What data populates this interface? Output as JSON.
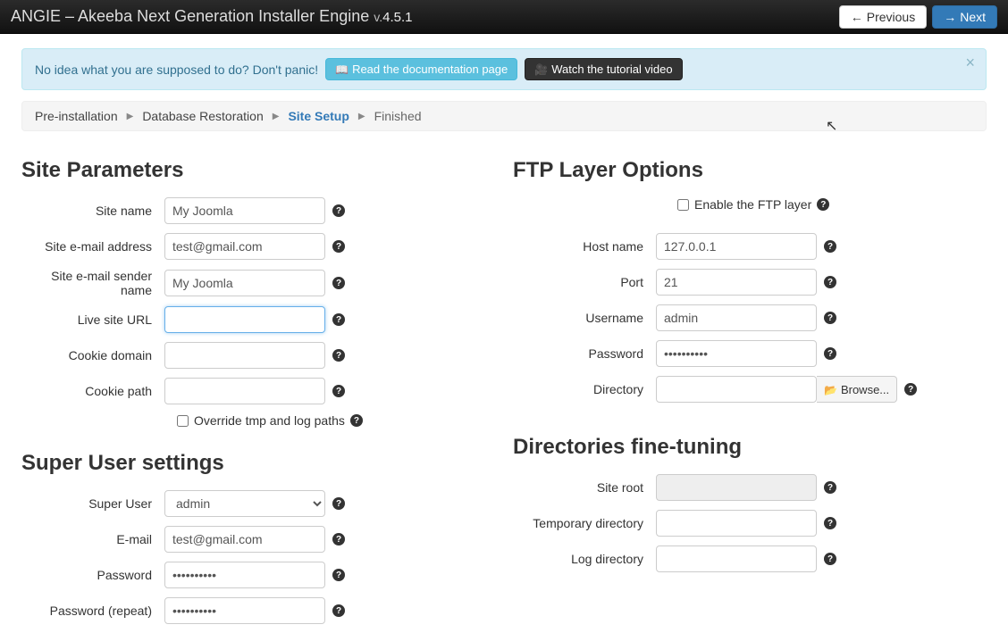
{
  "navbar": {
    "brand": "ANGIE – Akeeba Next Generation Installer Engine",
    "version_label": "v.",
    "version": "4.5.1",
    "prev": "Previous",
    "next": "Next"
  },
  "alert": {
    "text": "No idea what you are supposed to do? Don't panic!",
    "doc_btn": "Read the documentation page",
    "video_btn": "Watch the tutorial video"
  },
  "breadcrumb": {
    "items": [
      "Pre-installation",
      "Database Restoration",
      "Site Setup",
      "Finished"
    ],
    "active_index": 2
  },
  "site_params": {
    "heading": "Site Parameters",
    "labels": {
      "site_name": "Site name",
      "site_email": "Site e-mail address",
      "site_email_sender": "Site e-mail sender name",
      "live_url": "Live site URL",
      "cookie_domain": "Cookie domain",
      "cookie_path": "Cookie path",
      "override": "Override tmp and log paths"
    },
    "values": {
      "site_name": "My Joomla",
      "site_email": "test@gmail.com",
      "site_email_sender": "My Joomla",
      "live_url": "",
      "cookie_domain": "",
      "cookie_path": ""
    }
  },
  "ftp": {
    "heading": "FTP Layer Options",
    "enable_label": "Enable the FTP layer",
    "labels": {
      "host": "Host name",
      "port": "Port",
      "user": "Username",
      "pass": "Password",
      "dir": "Directory"
    },
    "values": {
      "host": "127.0.0.1",
      "port": "21",
      "user": "admin",
      "pass": "••••••••••",
      "dir": ""
    },
    "browse": "Browse..."
  },
  "superuser": {
    "heading": "Super User settings",
    "labels": {
      "user": "Super User",
      "email": "E-mail",
      "pass": "Password",
      "pass2": "Password (repeat)"
    },
    "values": {
      "user": "admin",
      "email": "test@gmail.com",
      "pass": "••••••••••",
      "pass2": "••••••••••"
    }
  },
  "dirs": {
    "heading": "Directories fine-tuning",
    "labels": {
      "root": "Site root",
      "tmp": "Temporary directory",
      "log": "Log directory"
    },
    "values": {
      "root": "",
      "tmp": "",
      "log": ""
    }
  }
}
